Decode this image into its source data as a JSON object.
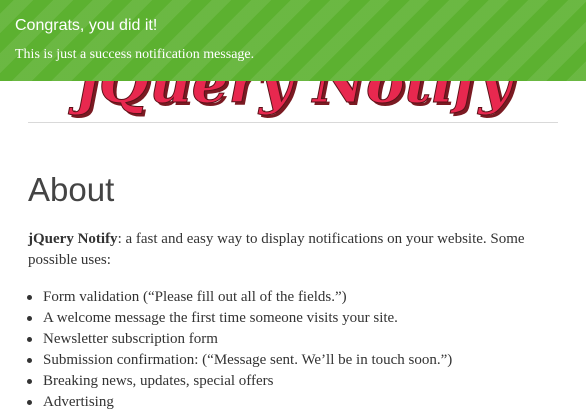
{
  "notification": {
    "title": "Congrats, you did it!",
    "message": "This is just a success notification message.",
    "color": "#5cb130"
  },
  "logo": {
    "text": "jQuery Notify",
    "color": "#e8284f"
  },
  "about": {
    "heading": "About",
    "intro_name": "jQuery Notify",
    "intro_text": ": a fast and easy way to display notifications on your website. Some possible uses:",
    "uses": [
      "Form validation (“Please fill out all of the fields.”)",
      "A welcome message the first time someone visits your site.",
      "Newsletter subscription form",
      "Submission confirmation: (“Message sent. We’ll be in touch soon.”)",
      "Breaking news, updates, special offers",
      "Advertising"
    ]
  }
}
